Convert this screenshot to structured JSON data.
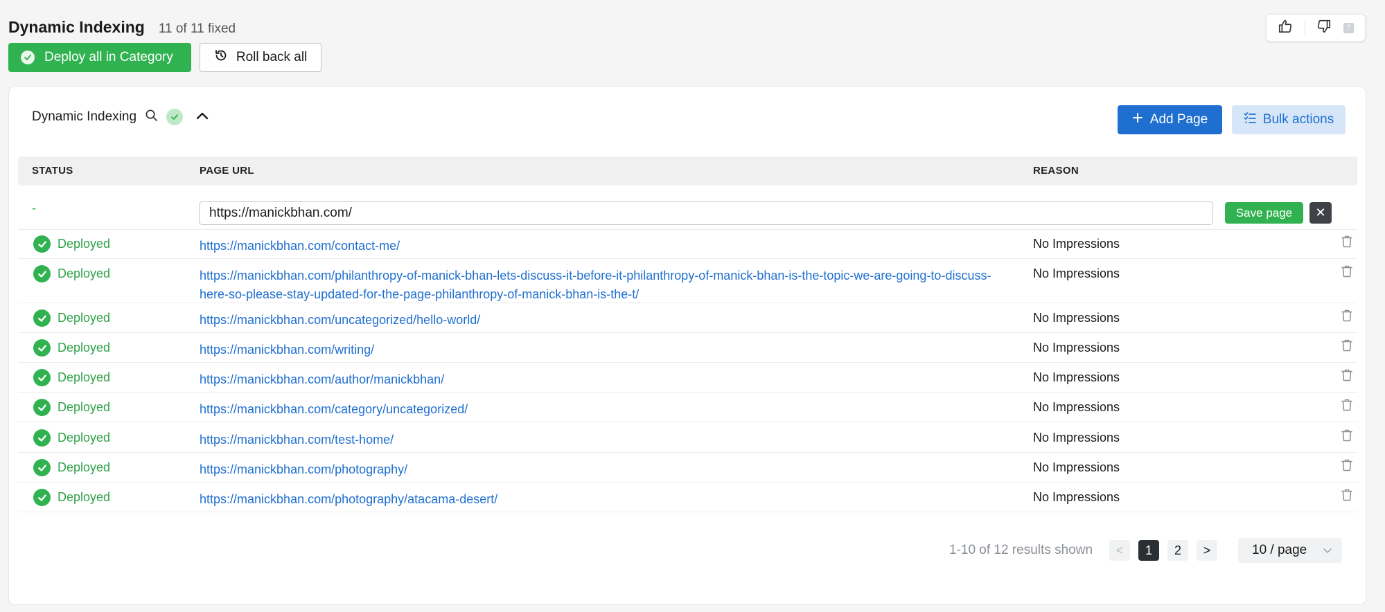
{
  "header": {
    "title": "Dynamic Indexing",
    "fixed_count": "11 of 11 fixed"
  },
  "actions": {
    "deploy_all": "Deploy all in Category",
    "roll_back_all": "Roll back all"
  },
  "feedback": {
    "like_icon": "thumbs-up-icon",
    "dislike_icon": "thumbs-down-icon",
    "help": "?"
  },
  "card": {
    "title": "Dynamic Indexing",
    "add_page": "Add Page",
    "bulk_actions": "Bulk actions"
  },
  "table": {
    "columns": {
      "status": "STATUS",
      "url": "PAGE URL",
      "reason": "REASON"
    },
    "edit_row": {
      "status": "-",
      "url_value": "https://manickbhan.com/",
      "save": "Save page",
      "close": "✕"
    },
    "rows": [
      {
        "status": "Deployed",
        "url": "https://manickbhan.com/contact-me/",
        "reason": "No Impressions"
      },
      {
        "status": "Deployed",
        "url": "https://manickbhan.com/philanthropy-of-manick-bhan-lets-discuss-it-before-it-philanthropy-of-manick-bhan-is-the-topic-we-are-going-to-discuss-here-so-please-stay-updated-for-the-page-philanthropy-of-manick-bhan-is-the-t/",
        "reason": "No Impressions"
      },
      {
        "status": "Deployed",
        "url": "https://manickbhan.com/uncategorized/hello-world/",
        "reason": "No Impressions"
      },
      {
        "status": "Deployed",
        "url": "https://manickbhan.com/writing/",
        "reason": "No Impressions"
      },
      {
        "status": "Deployed",
        "url": "https://manickbhan.com/author/manickbhan/",
        "reason": "No Impressions"
      },
      {
        "status": "Deployed",
        "url": "https://manickbhan.com/category/uncategorized/",
        "reason": "No Impressions"
      },
      {
        "status": "Deployed",
        "url": "https://manickbhan.com/test-home/",
        "reason": "No Impressions"
      },
      {
        "status": "Deployed",
        "url": "https://manickbhan.com/photography/",
        "reason": "No Impressions"
      },
      {
        "status": "Deployed",
        "url": "https://manickbhan.com/photography/atacama-desert/",
        "reason": "No Impressions"
      }
    ]
  },
  "pagination": {
    "summary": "1-10 of 12 results shown",
    "prev": "<",
    "pages": [
      "1",
      "2"
    ],
    "next": ">",
    "per_page": "10 / page"
  },
  "colors": {
    "green": "#2fb24f",
    "blue": "#1f6fd0",
    "dark": "#2b2f33"
  }
}
